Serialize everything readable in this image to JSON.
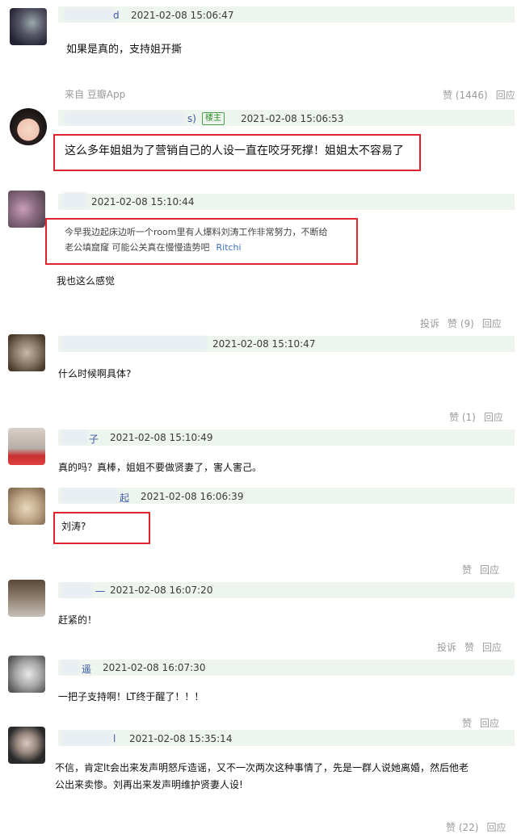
{
  "comments": [
    {
      "name": "d",
      "time": "2021-02-08 15:06:47",
      "text": "如果是真的，支持姐开撕",
      "source": "来自 豆瓣App",
      "likes": "赞 (1446)",
      "reply": "回应"
    },
    {
      "name": "s)",
      "badge": "楼主",
      "time": "2021-02-08 15:06:53",
      "text": "这么多年姐姐为了营销自己的人设一直在咬牙死撑！姐姐太不容易了"
    },
    {
      "time": "2021-02-08 15:10:44",
      "quote_line1": "今早我边起床边听一个room里有人爆料刘涛工作非常努力，不断给",
      "quote_line2": "老公填窟窿 可能公关真在慢慢造势吧",
      "quote_author": "Ritchi",
      "text": "我也这么感觉",
      "report": "投诉",
      "likes": "赞 (9)",
      "reply": "回应"
    },
    {
      "time": "2021-02-08 15:10:47",
      "text": "什么时候啊具体?",
      "likes": "赞 (1)",
      "reply": "回应"
    },
    {
      "name": "子",
      "time": "2021-02-08 15:10:49",
      "text": "真的吗？真棒，姐姐不要做贤妻了，害人害己。"
    },
    {
      "name": "起",
      "time": "2021-02-08 16:06:39",
      "text": "刘涛?",
      "likes": "赞",
      "reply": "回应"
    },
    {
      "name": "一",
      "time": "2021-02-08 16:07:20",
      "text": "赶紧的！",
      "report": "投诉",
      "likes": "赞",
      "reply": "回应"
    },
    {
      "name": "遥",
      "time": "2021-02-08 16:07:30",
      "text": "一把子支持啊！LT终于醒了！！！",
      "likes": "赞",
      "reply": "回应"
    },
    {
      "name": "l",
      "time": "2021-02-08 15:35:14",
      "text_line1": "不信，肯定lt会出来发声明怒斥造谣，又不一次两次这种事情了，先是一群人说她离婚，然后他老",
      "text_line2": "公出来卖惨。刘再出来发声明维护贤妻人设!",
      "likes": "赞 (22)",
      "reply": "回应"
    }
  ],
  "colors": {
    "highlight": "#e0242e",
    "header_bg": "#eef4ee",
    "link": "#3a6fc0"
  }
}
